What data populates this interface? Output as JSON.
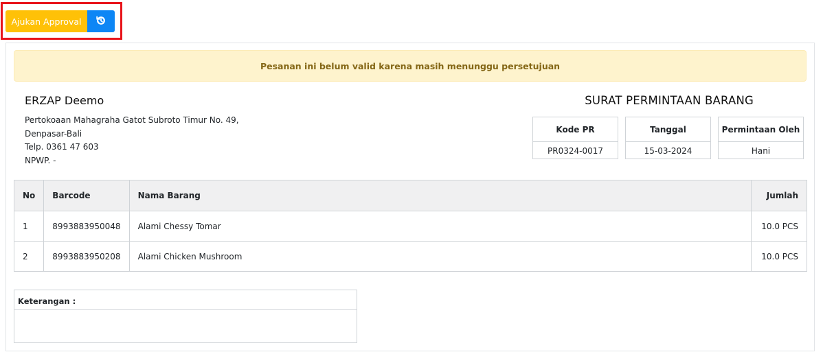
{
  "toolbar": {
    "approval_label": "Ajukan Approval",
    "history_icon": "history-icon",
    "approval_color": "#ffc107",
    "history_color": "#0d86f5",
    "highlight_color": "#e8141b"
  },
  "alert": {
    "message": "Pesanan ini belum valid karena masih menunggu persetujuan"
  },
  "company": {
    "name": "ERZAP Deemo",
    "address_line1": "Pertokoaan Mahagraha Gatot Subroto Timur No. 49,",
    "address_line2": "Denpasar-Bali",
    "phone": "Telp. 0361 47 603",
    "npwp": "NPWP. -"
  },
  "document": {
    "title": "SURAT PERMINTAAN BARANG",
    "kode_pr_label": "Kode PR",
    "kode_pr_value": "PR0324-0017",
    "tanggal_label": "Tanggal",
    "tanggal_value": "15-03-2024",
    "permintaan_label": "Permintaan Oleh",
    "permintaan_value": "Hani"
  },
  "table": {
    "headers": {
      "no": "No",
      "barcode": "Barcode",
      "nama": "Nama Barang",
      "jumlah": "Jumlah"
    },
    "rows": [
      {
        "no": "1",
        "barcode": "8993883950048",
        "nama": "Alami Chessy Tomar",
        "jumlah": "10.0 PCS"
      },
      {
        "no": "2",
        "barcode": "8993883950208",
        "nama": "Alami Chicken Mushroom",
        "jumlah": "10.0 PCS"
      }
    ]
  },
  "notes": {
    "label": "Keterangan :",
    "value": ""
  }
}
